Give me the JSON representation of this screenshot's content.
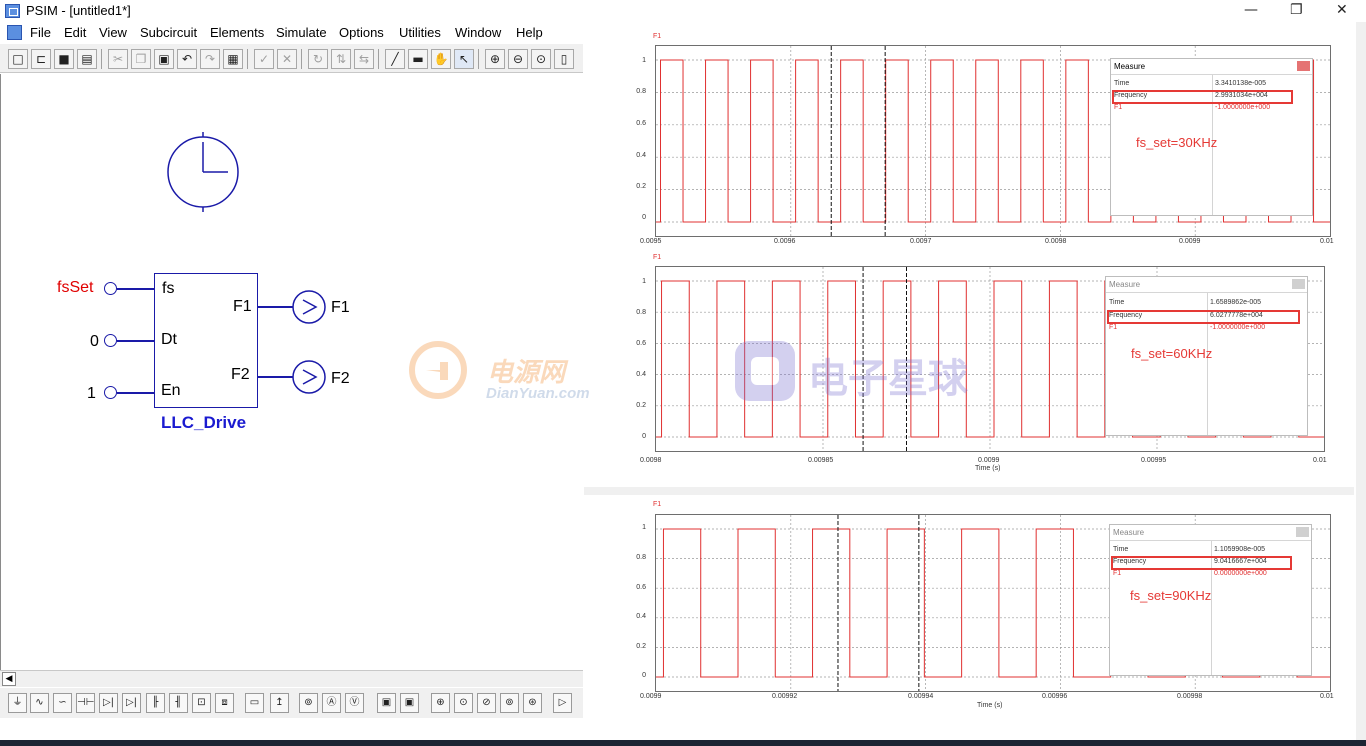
{
  "window": {
    "title": "PSIM - [untitled1*]",
    "controls": {
      "minimize": "—",
      "restore": "❐",
      "close": "✕"
    }
  },
  "menu": [
    "File",
    "Edit",
    "View",
    "Subcircuit",
    "Elements",
    "Simulate",
    "Options",
    "Utilities",
    "Window",
    "Help"
  ],
  "toolbar_icons": [
    "new-icon",
    "open-icon",
    "save-icon",
    "print-icon",
    "cut-icon",
    "copy-icon",
    "paste-icon",
    "undo-icon",
    "redo-icon",
    "clipboard-icon",
    "check-icon",
    "escape-icon",
    "rotate-icon",
    "flip-icon",
    "mirror-icon",
    "wire-icon",
    "label-icon",
    "pan-hand-icon",
    "select-arrow-icon",
    "zoom-in-icon",
    "zoom-out-icon",
    "zoom-fit-icon",
    "page-icon"
  ],
  "schematic": {
    "inputs": [
      {
        "label": "fsSet",
        "pin": "fs",
        "color": "#e00000"
      },
      {
        "label": "0",
        "pin": "Dt",
        "color": "#000000"
      },
      {
        "label": "1",
        "pin": "En",
        "color": "#000000"
      }
    ],
    "outputs": [
      {
        "pin": "F1",
        "probe": "F1"
      },
      {
        "pin": "F2",
        "probe": "F2"
      }
    ],
    "block_name": "LLC_Drive",
    "block_name_color": "#1a1ad0"
  },
  "element_bar_icons": [
    "ground-icon",
    "resistor-icon",
    "inductor-icon",
    "capacitor-icon",
    "diode-icon",
    "thyristor-icon",
    "mosfet-icon",
    "igbt-icon",
    "switch-icon",
    "transformer-icon",
    "comparator-icon",
    "voltage-probe-icon",
    "current-probe-icon",
    "ammeter-icon",
    "scope-icon",
    "dc-source-icon",
    "ac-source-icon",
    "step-source-icon",
    "triangle-source-icon",
    "current-source-icon",
    "control-icon"
  ],
  "plots": [
    {
      "series": "F1",
      "x_ticks": [
        "0.0095",
        "0.0096",
        "0.0097",
        "0.0098",
        "0.0099",
        "0.01"
      ],
      "y_ticks": [
        "1",
        "0.8",
        "0.6",
        "0.4",
        "0.2",
        "0"
      ],
      "x_label": "",
      "measure": {
        "title": "Measure",
        "rows": [
          {
            "name": "Time",
            "value": "3.3410138e-005"
          },
          {
            "name": "Frequency",
            "value": "2.9931034e+004"
          },
          {
            "name": "F1",
            "value": "-1.0000000e+000"
          }
        ],
        "annotation": "fs_set=30KHz"
      }
    },
    {
      "series": "F1",
      "x_ticks": [
        "0.0098",
        "0.00985",
        "0.0099",
        "0.00995",
        "0.01"
      ],
      "y_ticks": [
        "1",
        "0.8",
        "0.6",
        "0.4",
        "0.2",
        "0"
      ],
      "x_label": "Time (s)",
      "measure": {
        "title": "Measure",
        "rows": [
          {
            "name": "Time",
            "value": "1.6589862e-005"
          },
          {
            "name": "Frequency",
            "value": "6.0277778e+004"
          },
          {
            "name": "F1",
            "value": "-1.0000000e+000"
          }
        ],
        "annotation": "fs_set=60KHz"
      }
    },
    {
      "series": "F1",
      "x_ticks": [
        "0.0099",
        "0.00992",
        "0.00994",
        "0.00996",
        "0.00998",
        "0.01"
      ],
      "y_ticks": [
        "1",
        "0.8",
        "0.6",
        "0.4",
        "0.2",
        "0"
      ],
      "x_label": "Time (s)",
      "measure": {
        "title": "Measure",
        "rows": [
          {
            "name": "Time",
            "value": "1.1059908e-005"
          },
          {
            "name": "Frequency",
            "value": "9.0416667e+004"
          },
          {
            "name": "F1",
            "value": "0.0000000e+000"
          }
        ],
        "annotation": "fs_set=90KHz"
      }
    }
  ],
  "chart_data": [
    {
      "type": "line",
      "series": [
        {
          "name": "F1",
          "frequency_hz": 29931,
          "duty": 0.5,
          "low": 0,
          "high": 1
        }
      ],
      "xlim": [
        0.0095,
        0.01
      ],
      "ylim": [
        0,
        1
      ]
    },
    {
      "type": "line",
      "series": [
        {
          "name": "F1",
          "frequency_hz": 60278,
          "duty": 0.5,
          "low": 0,
          "high": 1
        }
      ],
      "xlim": [
        0.0098,
        0.01
      ],
      "ylim": [
        0,
        1
      ]
    },
    {
      "type": "line",
      "series": [
        {
          "name": "F1",
          "frequency_hz": 90417,
          "duty": 0.5,
          "low": 0,
          "high": 1
        }
      ],
      "xlim": [
        0.0099,
        0.01
      ],
      "ylim": [
        0,
        1
      ]
    }
  ],
  "watermarks": {
    "a_cn": "电源网",
    "a_en": "DianYuan.com",
    "b_cn": "电子星球"
  },
  "colors": {
    "trace": "#e03030",
    "schematic": "#1a1aa8",
    "highlight": "#e53935"
  }
}
